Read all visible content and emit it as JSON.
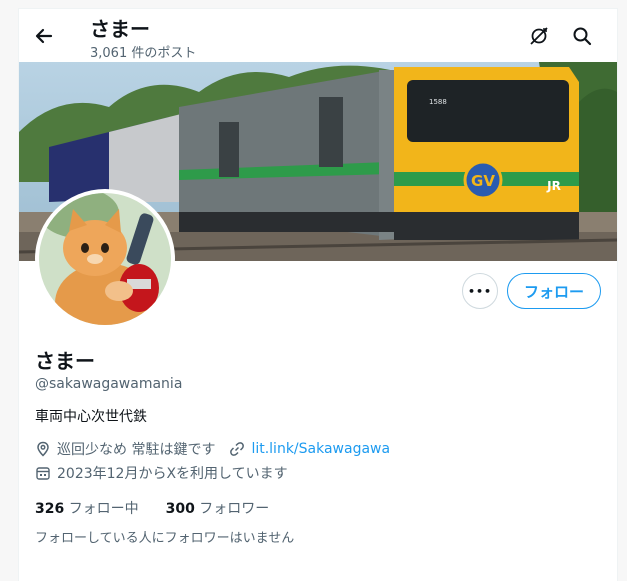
{
  "header": {
    "title": "さまー",
    "post_count": "3,061 件のポスト",
    "back_icon": "arrow-left-icon",
    "action_icons": [
      "translate-slash-icon",
      "search-icon"
    ]
  },
  "profile": {
    "display_name": "さまー",
    "handle": "@sakawagawamania",
    "bio": "車両中心次世代鉄",
    "location": "巡回少なめ 常駐は鍵です",
    "link": "lit.link/Sakawagawa",
    "joined": "2023年12月からXを利用しています",
    "following_count": "326",
    "following_label": "フォロー中",
    "followers_count": "300",
    "followers_label": "フォロワー",
    "mutuals_notice": "フォローしている人にフォロワーはいません"
  },
  "actions": {
    "more_label": "•••",
    "follow_label": "フォロー"
  },
  "banner": {
    "train_badge": "GV",
    "train_logo": "JR",
    "train_number": "1588"
  },
  "colors": {
    "accent": "#1d9bf0",
    "train_yellow": "#f2b51a",
    "train_green": "#2e9b4a",
    "train_gray": "#6e7779"
  }
}
